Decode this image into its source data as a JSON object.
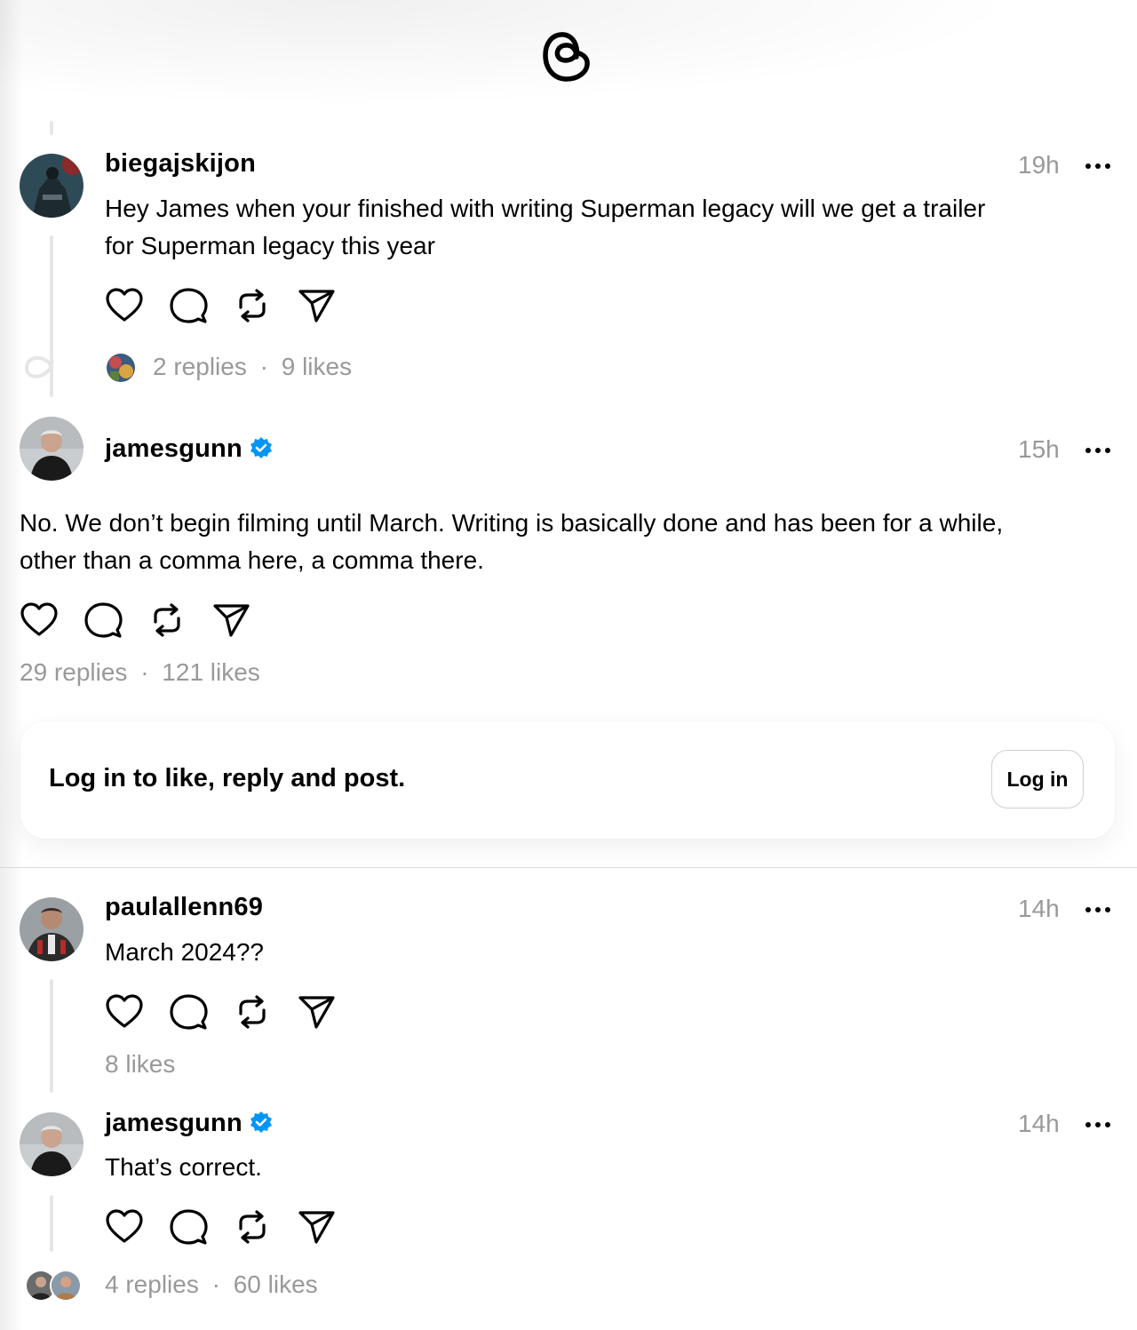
{
  "colors": {
    "accent_verified": "#0095f6",
    "muted": "#999999",
    "line": "#e6e6e6"
  },
  "icons": [
    "threads-logo-icon",
    "heart-icon",
    "comment-icon",
    "repost-icon",
    "share-icon",
    "more-icon",
    "verified-badge-icon"
  ],
  "posts": [
    {
      "username": "biegajskijon",
      "time": "19h",
      "text_line1": "Hey James when your finished with writing Superman legacy will we get a trailer",
      "text_line2": "for Superman legacy this year",
      "replies": "2 replies",
      "sep": "·",
      "likes": "9 likes"
    },
    {
      "username": "jamesgunn",
      "verified": true,
      "time": "15h",
      "text_line1": "No. We don’t begin filming until March. Writing is basically done and has been for a while,",
      "text_line2": "other than a comma here, a comma there.",
      "replies": "29 replies",
      "sep": "·",
      "likes": "121 likes"
    },
    {
      "username": "paulallenn69",
      "time": "14h",
      "text": "March 2024??",
      "likes": "8 likes"
    },
    {
      "username": "jamesgunn",
      "verified": true,
      "time": "14h",
      "text": "That’s correct.",
      "replies": "4 replies",
      "sep": "·",
      "likes": "60 likes"
    }
  ],
  "login_prompt": {
    "text": "Log in to like, reply and post.",
    "button": "Log in"
  }
}
